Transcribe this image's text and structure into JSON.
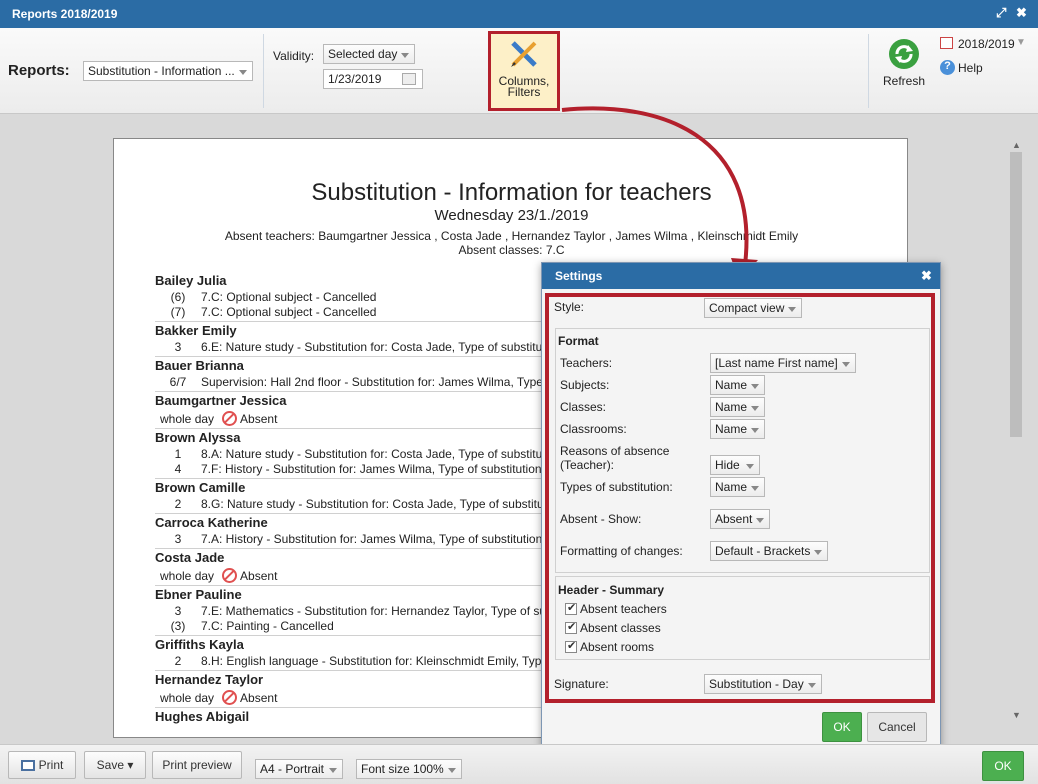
{
  "window": {
    "title": "Reports 2018/2019"
  },
  "toolbar": {
    "reports_label": "Reports:",
    "report_select": "Substitution - Information ...",
    "validity_label": "Validity:",
    "validity_select": "Selected day",
    "date_value": "1/23/2019",
    "columns_filters": "Columns, Filters",
    "refresh": "Refresh",
    "year": "2018/2019",
    "help": "Help"
  },
  "document": {
    "title": "Substitution - Information for teachers",
    "date": "Wednesday 23/1./2019",
    "absent_teachers": "Absent teachers: Baumgartner Jessica , Costa Jade , Hernandez Taylor , James Wilma , Kleinschmidt Emily",
    "absent_classes": "Absent classes: 7.C",
    "entries": [
      {
        "name": "Bailey Julia",
        "rows": [
          {
            "period": "(6)",
            "text": "7.C: Optional subject - Cancelled"
          },
          {
            "period": "(7)",
            "text": "7.C: Optional subject - Cancelled"
          }
        ]
      },
      {
        "name": "Bakker Emily",
        "rows": [
          {
            "period": "3",
            "text": "6.E: Nature study - Substitution for: Costa Jade, Type of substitu"
          }
        ]
      },
      {
        "name": "Bauer Brianna",
        "rows": [
          {
            "period": "6/7",
            "text": "Supervision: Hall 2nd floor - Substitution for: James Wilma, Type"
          }
        ]
      },
      {
        "name": "Baumgartner Jessica",
        "absent": {
          "day": "whole day",
          "label": "Absent"
        }
      },
      {
        "name": "Brown Alyssa",
        "rows": [
          {
            "period": "1",
            "text": "8.A: Nature study - Substitution for: Costa Jade, Type of substitu"
          },
          {
            "period": "4",
            "text": "7.F: History - Substitution for: James Wilma, Type of substitution"
          }
        ]
      },
      {
        "name": "Brown Camille",
        "rows": [
          {
            "period": "2",
            "text": "8.G: Nature study - Substitution for: Costa Jade, Type of substitu"
          }
        ]
      },
      {
        "name": "Carroca Katherine",
        "rows": [
          {
            "period": "3",
            "text": "7.A: History - Substitution for: James Wilma, Type of substitution"
          }
        ]
      },
      {
        "name": "Costa Jade",
        "absent": {
          "day": "whole day",
          "label": "Absent"
        }
      },
      {
        "name": "Ebner Pauline",
        "rows": [
          {
            "period": "3",
            "text": "7.E: Mathematics - Substitution for: Hernandez Taylor, Type of su"
          },
          {
            "period": "(3)",
            "text": "7.C: Painting - Cancelled"
          }
        ]
      },
      {
        "name": "Griffiths Kayla",
        "rows": [
          {
            "period": "2",
            "text": "8.H: English language - Substitution for: Kleinschmidt Emily, Typ"
          }
        ]
      },
      {
        "name": "Hernandez Taylor",
        "absent": {
          "day": "whole day",
          "label": "Absent"
        }
      },
      {
        "name": "Hughes Abigail"
      }
    ]
  },
  "settings": {
    "title": "Settings",
    "style_label": "Style:",
    "style_value": "Compact view",
    "format_header": "Format",
    "teachers_label": "Teachers:",
    "teachers_value": "[Last name First name]",
    "subjects_label": "Subjects:",
    "subjects_value": "Name",
    "classes_label": "Classes:",
    "classes_value": "Name",
    "classrooms_label": "Classrooms:",
    "classrooms_value": "Name",
    "reasons_label_1": "Reasons of absence",
    "reasons_label_2": "(Teacher):",
    "reasons_value": "Hide",
    "types_label": "Types of substitution:",
    "types_value": "Name",
    "absent_show_label": "Absent - Show:",
    "absent_show_value": "Absent",
    "formatting_label": "Formatting of changes:",
    "formatting_value": "Default - Brackets",
    "header_summary": "Header - Summary",
    "check_teachers": "Absent teachers",
    "check_classes": "Absent classes",
    "check_rooms": "Absent rooms",
    "signature_label": "Signature:",
    "signature_value": "Substitution - Day",
    "ok": "OK",
    "cancel": "Cancel"
  },
  "bottombar": {
    "print": "Print",
    "save": "Save ▾",
    "print_preview": "Print preview",
    "paper": "A4 - Portrait",
    "font_size": "Font size 100%",
    "ok": "OK"
  },
  "colors": {
    "titlebar": "#2b6ca5",
    "highlight": "#b3202c",
    "ok_green": "#4caf50"
  }
}
